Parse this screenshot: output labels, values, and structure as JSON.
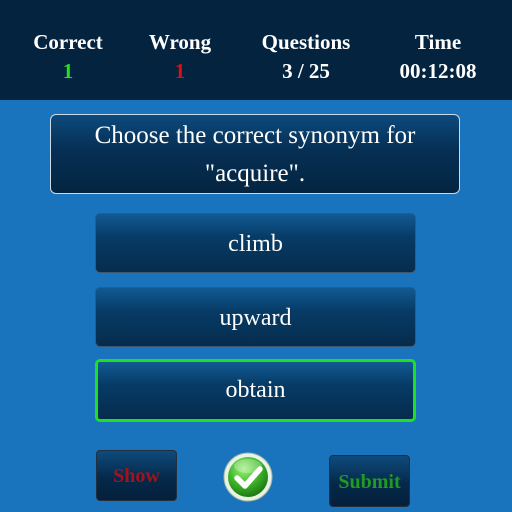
{
  "header": {
    "correct_label": "Correct",
    "correct_value": "1",
    "wrong_label": "Wrong",
    "wrong_value": "1",
    "questions_label": "Questions",
    "questions_value": "3 / 25",
    "time_label": "Time",
    "time_value": "00:12:08"
  },
  "question": {
    "line1": "Choose the correct synonym for",
    "line2": "\"acquire\"."
  },
  "options": [
    {
      "label": "climb",
      "selected": false
    },
    {
      "label": "upward",
      "selected": false
    },
    {
      "label": "obtain",
      "selected": true
    }
  ],
  "buttons": {
    "show_label": "Show",
    "submit_label": "Submit",
    "check_icon": "check-icon"
  },
  "colors": {
    "background": "#1a74bd",
    "header": "#04233f",
    "correct_value": "#22e022",
    "wrong_value": "#e01010",
    "selected_border": "#1ee023",
    "show_text": "#a2141a",
    "submit_text": "#1f9a25"
  }
}
